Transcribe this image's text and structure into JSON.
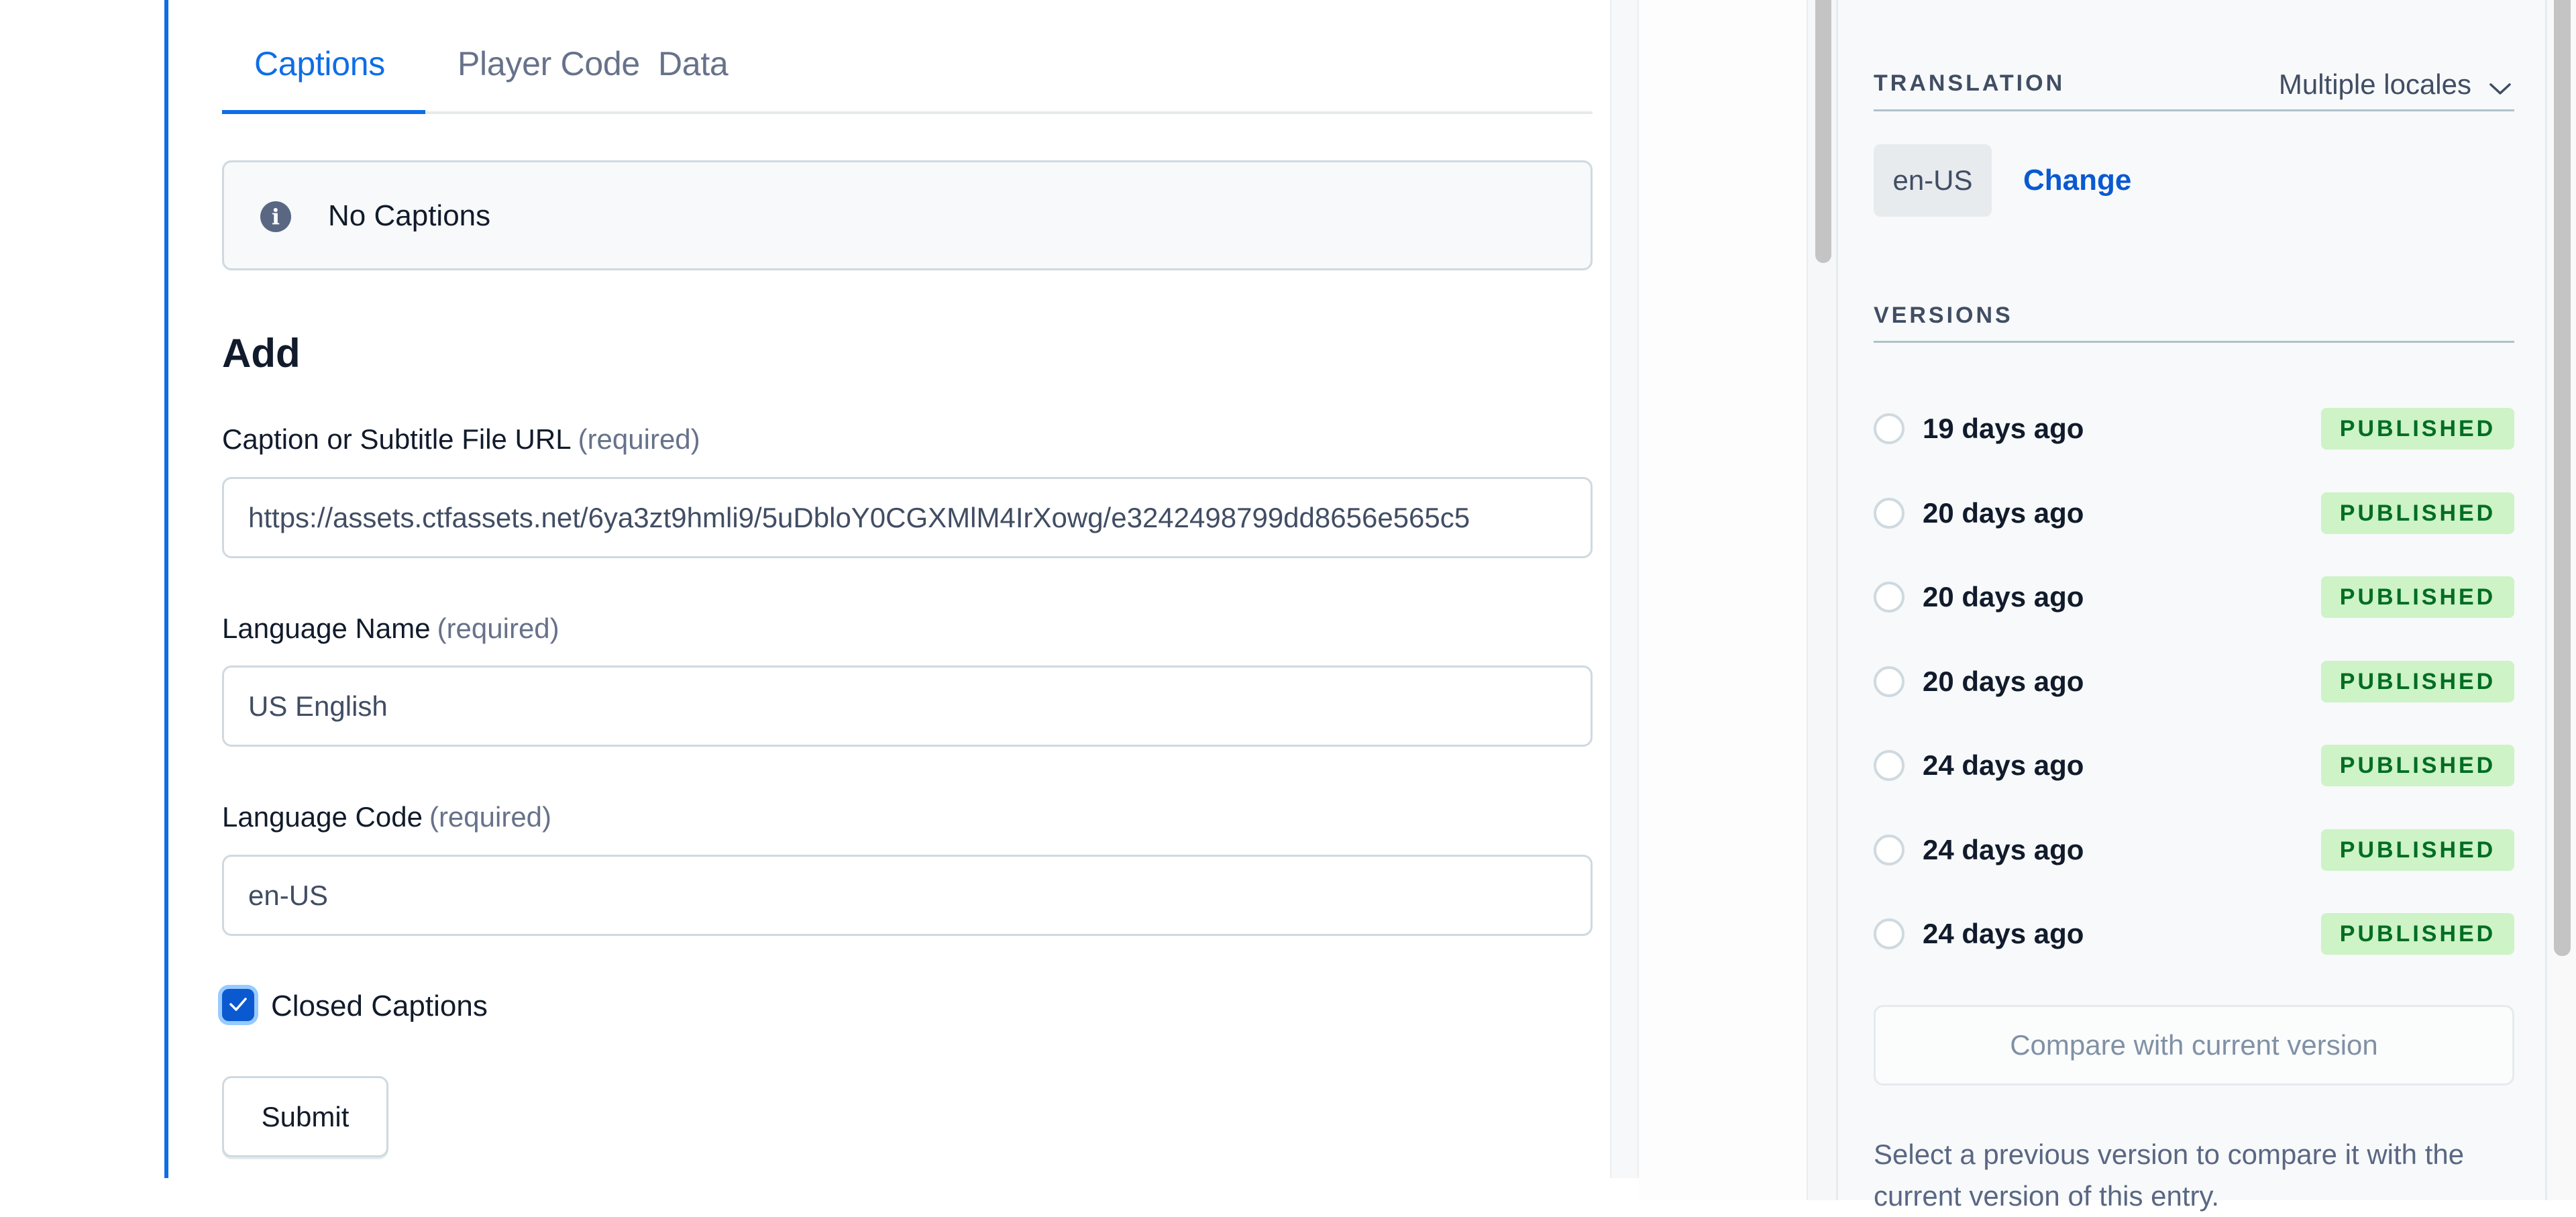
{
  "colors": {
    "accent": "#0e6ee6",
    "link": "#0a59d1",
    "badge_bg": "#cdf3c6",
    "badge_text": "#006d23"
  },
  "editor": {
    "tabs": [
      {
        "label": "Captions",
        "active": true
      },
      {
        "label": "Player Code",
        "active": false
      },
      {
        "label": "Data",
        "active": false
      }
    ],
    "callout": {
      "icon": "info-icon",
      "text": "No Captions"
    },
    "add_heading": "Add",
    "fields": [
      {
        "label": "Caption or Subtitle File URL",
        "required_text": "(required)",
        "value": "https://assets.ctfassets.net/6ya3zt9hmli9/5uDbloY0CGXMlM4IrXowg/e3242498799dd8656e565c5"
      },
      {
        "label": "Language Name",
        "required_text": "(required)",
        "value": "US English"
      },
      {
        "label": "Language Code",
        "required_text": "(required)",
        "value": "en-US"
      }
    ],
    "closed_captions": {
      "label": "Closed Captions",
      "checked": true
    },
    "submit_label": "Submit"
  },
  "sidebar": {
    "translation": {
      "title": "TRANSLATION",
      "locale_select": "Multiple locales",
      "locale_chip": "en-US",
      "change_link": "Change"
    },
    "versions": {
      "title": "VERSIONS",
      "items": [
        {
          "date": "19 days ago",
          "status": "PUBLISHED"
        },
        {
          "date": "20 days ago",
          "status": "PUBLISHED"
        },
        {
          "date": "20 days ago",
          "status": "PUBLISHED"
        },
        {
          "date": "20 days ago",
          "status": "PUBLISHED"
        },
        {
          "date": "24 days ago",
          "status": "PUBLISHED"
        },
        {
          "date": "24 days ago",
          "status": "PUBLISHED"
        },
        {
          "date": "24 days ago",
          "status": "PUBLISHED"
        }
      ],
      "compare_button": "Compare with current version",
      "help_text": "Select a previous version to compare it with the current version of this entry."
    }
  }
}
